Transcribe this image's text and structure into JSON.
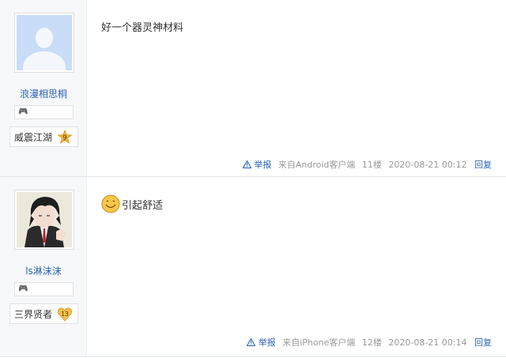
{
  "posts": [
    {
      "username": "浪漫相思桐",
      "level_name": "威震江湖",
      "level": "9",
      "content": "好一个器灵神材料",
      "report": "举报",
      "client": "来自Android客户端",
      "floor": "11楼",
      "time": "2020-08-21 00:12",
      "reply": "回复",
      "avatar": "default-avatar"
    },
    {
      "username": "ls淋沫沫",
      "level_name": "三界贤者",
      "level": "13",
      "content": "引起舒适",
      "report": "举报",
      "client": "来自iPhone客户端",
      "floor": "12楼",
      "time": "2020-08-21 00:14",
      "reply": "回复",
      "avatar": "anime-avatar"
    }
  ],
  "colors": {
    "link": "#2d64b3",
    "meta": "#999999",
    "sidebar": "#f7f8fa",
    "level9_badge": "#f4b740",
    "level13_badge": "#f2c14e"
  }
}
